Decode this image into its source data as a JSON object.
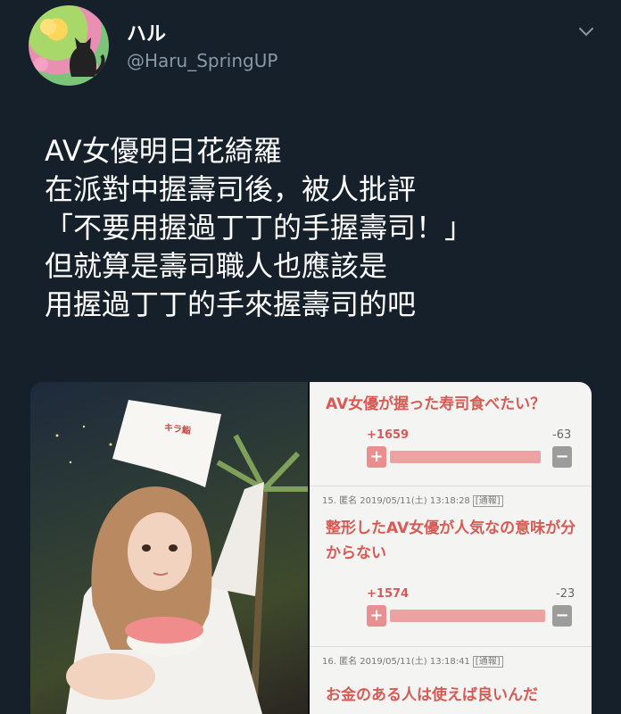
{
  "author": {
    "display_name": "ハル",
    "handle": "@Haru_SpringUP",
    "avatar_icon": "cat-silhouette-flowers-avatar"
  },
  "menu_icon": "chevron-down-icon",
  "tweet": {
    "lines": [
      "AV女優明日花綺羅",
      "在派對中握壽司後，被人批評",
      "「不要用握過丁丁的手握壽司！」",
      "但就算是壽司職人也應該是",
      "用握過丁丁的手來握壽司的吧"
    ]
  },
  "media": {
    "hat_text": "キラ鮨",
    "comments": [
      {
        "text": "AV女優が握った寿司食べたい？",
        "plus": "+1659",
        "minus": "-63",
        "plus_share": 0.963
      },
      {
        "meta": "15. 匿名 2019/05/11(土) 13:18:28",
        "report": "[通報]",
        "text": "整形したAV女優が人気なの意味が分からない",
        "plus": "+1574",
        "minus": "-23",
        "plus_share": 0.986
      },
      {
        "meta": "16. 匿名 2019/05/11(土) 13:18:41",
        "report": "[通報]",
        "text": "お金のある人は使えば良いんだ"
      }
    ],
    "vote_plus_symbol": "+",
    "vote_minus_symbol": "−"
  },
  "colors": {
    "background": "#15202b",
    "secondary_text": "#8899a6",
    "comment_accent": "#d75a55"
  }
}
